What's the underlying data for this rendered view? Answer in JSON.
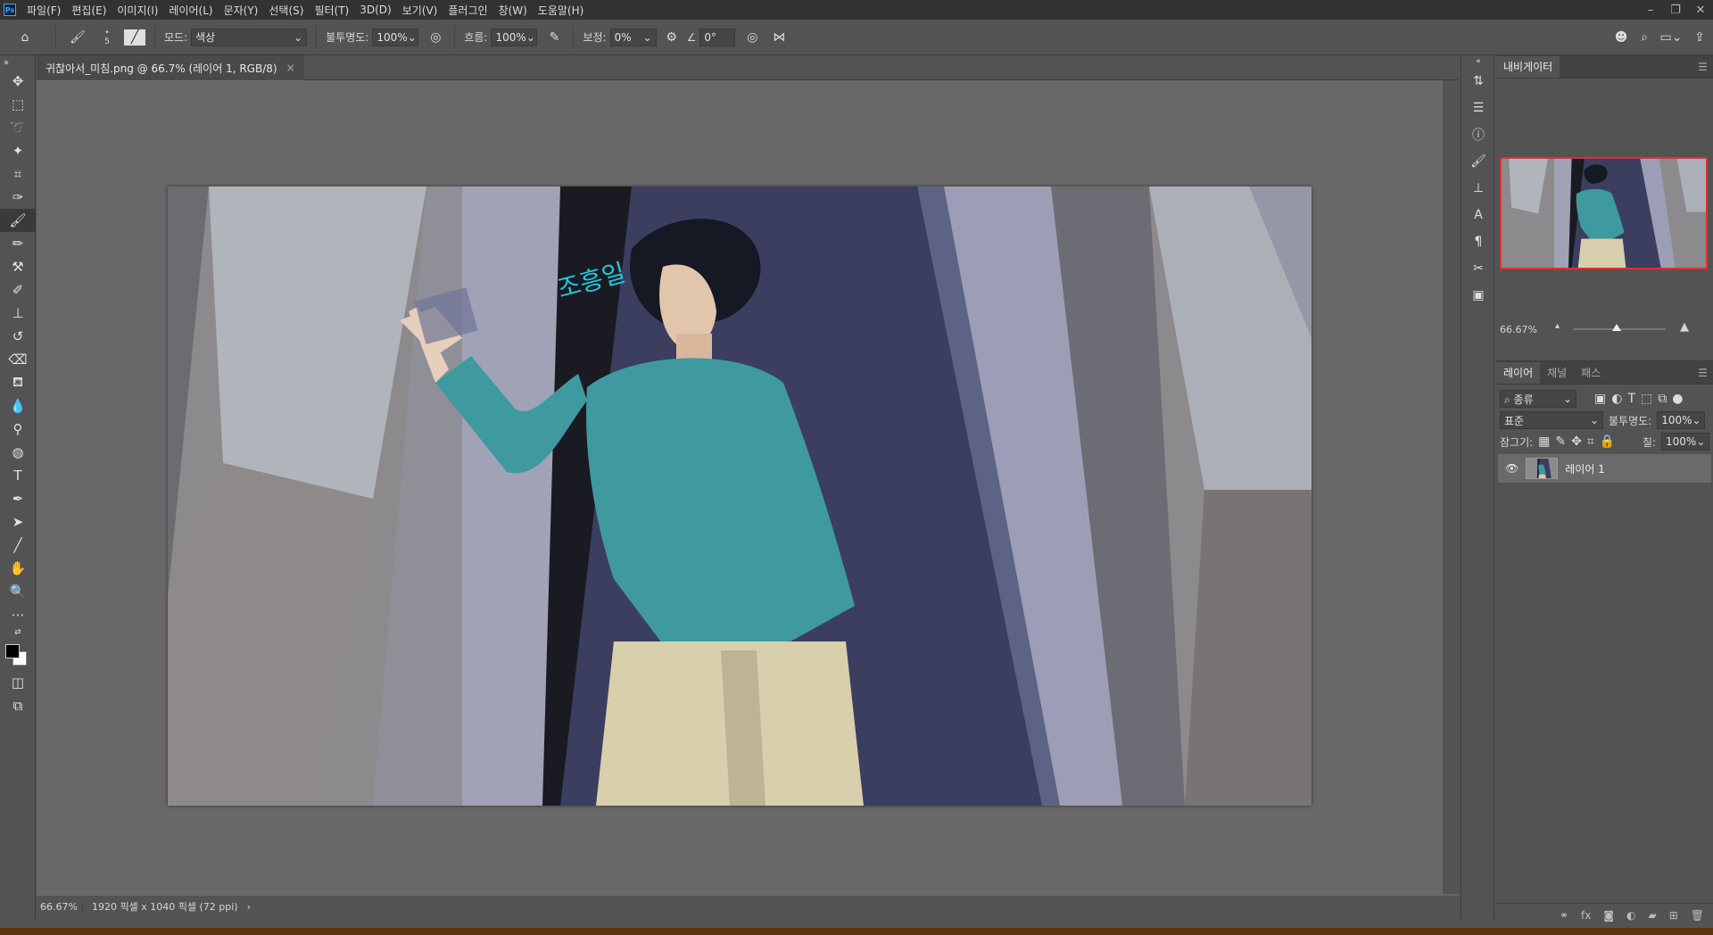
{
  "menubar": {
    "logo": "Ps",
    "items": [
      "파일(F)",
      "편집(E)",
      "이미지(I)",
      "레이어(L)",
      "문자(Y)",
      "선택(S)",
      "필터(T)",
      "3D(D)",
      "보기(V)",
      "플러그인",
      "창(W)",
      "도움말(H)"
    ]
  },
  "options": {
    "brush_size": "5",
    "mode_label": "모드:",
    "mode_value": "색상",
    "opacity_label": "불투명도:",
    "opacity_value": "100%",
    "flow_label": "흐름:",
    "flow_value": "100%",
    "smoothing_label": "보정:",
    "smoothing_value": "0%",
    "angle_value": "0°"
  },
  "document": {
    "tab_title": "귀찮아서_미침.png @ 66.7% (레이어 1, RGB/8)",
    "close": "×"
  },
  "status": {
    "zoom": "66.67%",
    "info": "1920 픽셀 x 1040 픽셀 (72 ppi)",
    "arrow": "›"
  },
  "canvas_text": "조흥일",
  "navigator": {
    "tab": "내비게이터",
    "zoom": "66.67%"
  },
  "layers_panel": {
    "tabs": [
      "레이어",
      "채널",
      "패스"
    ],
    "filter_kind": "종류",
    "blend_mode": "표준",
    "opacity_label": "불투명도:",
    "opacity_value": "100%",
    "lock_label": "잠그기:",
    "fill_label": "칠:",
    "fill_value": "100%",
    "layers": [
      {
        "name": "레이어 1",
        "visible": true
      }
    ]
  },
  "colors": {
    "foreground": "#000000",
    "background": "#ffffff",
    "accent": "#e03030"
  }
}
